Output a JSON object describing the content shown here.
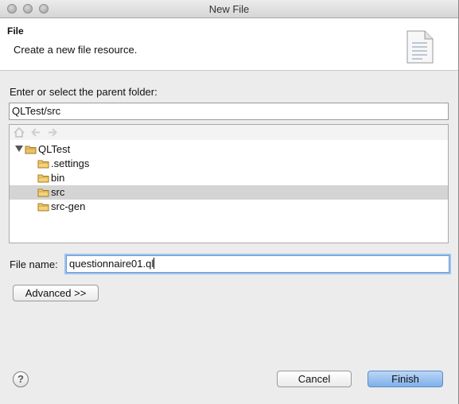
{
  "window": {
    "title": "New File"
  },
  "banner": {
    "title": "File",
    "description": "Create a new file resource.",
    "icon": "file-document-icon"
  },
  "parent_folder": {
    "label": "Enter or select the parent folder:",
    "value": "QLTest/src"
  },
  "tree": {
    "toolbar_icons": [
      "home-icon",
      "back-arrow-icon",
      "forward-arrow-icon"
    ],
    "items": [
      {
        "label": "QLTest",
        "expanded": true,
        "level": 0,
        "selected": false
      },
      {
        "label": ".settings",
        "level": 1,
        "selected": false
      },
      {
        "label": "bin",
        "level": 1,
        "selected": false
      },
      {
        "label": "src",
        "level": 1,
        "selected": true
      },
      {
        "label": "src-gen",
        "level": 1,
        "selected": false
      }
    ]
  },
  "file_name": {
    "label": "File name:",
    "value": "questionnaire01.ql"
  },
  "buttons": {
    "advanced": "Advanced >>",
    "cancel": "Cancel",
    "finish": "Finish",
    "help": "?"
  },
  "colors": {
    "finish_button": "#7fb0ea",
    "selection": "#d4d4d4",
    "focus_ring": "#9ec2ee"
  }
}
